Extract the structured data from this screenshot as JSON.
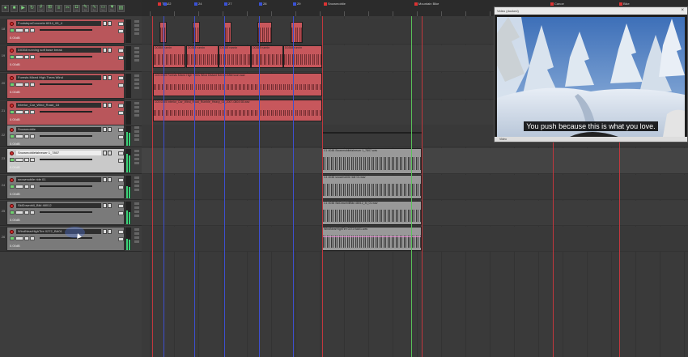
{
  "toolbar": {
    "buttons": [
      {
        "icon": "record-icon",
        "label": ""
      },
      {
        "icon": "stop-icon",
        "label": ""
      },
      {
        "icon": "play-icon",
        "label": ""
      },
      {
        "icon": "loop-icon",
        "label": ""
      },
      {
        "icon": "grid-icon",
        "label": "Grid"
      },
      {
        "icon": "snap-icon",
        "label": "Snap"
      },
      {
        "icon": "ripple-icon",
        "label": ""
      },
      {
        "icon": "trim-icon",
        "label": ""
      },
      {
        "icon": "lock-icon",
        "label": "Lock"
      },
      {
        "icon": "edit-icon",
        "label": "Edit"
      },
      {
        "icon": "envelope-icon",
        "label": "Env"
      },
      {
        "icon": "item-icon",
        "label": "Item"
      },
      {
        "icon": "marker-icon",
        "label": "Mark"
      },
      {
        "icon": "region-icon",
        "label": ""
      }
    ]
  },
  "markers": [
    {
      "label": "Tick",
      "color": "#d33"
    },
    {
      "label": "22",
      "color": "#3a52d6"
    },
    {
      "label": "24",
      "color": "#3a52d6"
    },
    {
      "label": "27",
      "color": "#3a52d6"
    },
    {
      "label": "28",
      "color": "#3a52d6"
    },
    {
      "label": "29",
      "color": "#3a52d6"
    },
    {
      "label": "Snowmobile",
      "color": "#d33"
    },
    {
      "label": "Mountain Bike",
      "color": "#d33"
    },
    {
      "label": "Canoe",
      "color": "#d33"
    },
    {
      "label": "Bike",
      "color": "#d33"
    }
  ],
  "tracks": [
    {
      "num": "18",
      "name": "FootstepsConcrete 6014_05_4",
      "volume": "0.00dB",
      "kind": "red"
    },
    {
      "num": "19",
      "name": "D0358 running soft base break",
      "volume": "0.00dB",
      "kind": "red"
    },
    {
      "num": "20",
      "name": "Forests Mixed High Trees Wind",
      "volume": "0.00dB",
      "kind": "red"
    },
    {
      "num": "21",
      "name": "Interior_Car_Wind_Road_18",
      "volume": "0.00dB",
      "kind": "red"
    },
    {
      "num": "22",
      "name": "Snowmobile",
      "volume": "0.00dB",
      "kind": "folder"
    },
    {
      "num": "23",
      "name": "Snowmobilefahreuer 1_7807",
      "volume": "0.00dB",
      "kind": "light"
    },
    {
      "num": "24",
      "name": "snowmobile ride 01",
      "volume": "0.00dB",
      "kind": "gray"
    },
    {
      "num": "25",
      "name": "SkiDownhill_Bikl 48012",
      "volume": "0.00dB",
      "kind": "gray"
    },
    {
      "num": "26",
      "name": "WindNearHighTire 0272_BA01",
      "volume": "0.00dB",
      "kind": "gray"
    }
  ],
  "track_side_label": "upmixe",
  "items": [
    {
      "label": "",
      "kind": "red"
    },
    {
      "label": "",
      "kind": "red"
    },
    {
      "label": "",
      "kind": "red"
    },
    {
      "label": "",
      "kind": "red"
    },
    {
      "label": "",
      "kind": "red"
    },
    {
      "label": "D0358 runnin",
      "kind": "red"
    },
    {
      "label": "D0358 runnin",
      "kind": "red"
    },
    {
      "label": "D0358 runnin",
      "kind": "red"
    },
    {
      "label": "D0358 runnin",
      "kind": "red"
    },
    {
      "label": "D0358 runnin",
      "kind": "red"
    },
    {
      "label": "C03 0385 Forests Mixed High Trees Wind Distant Nerrad Afternoon.wav",
      "kind": "red"
    },
    {
      "label": "C03 0385 Interior_Car_Wind_Road_Rumble_Heavy_01_2007-0804 08.wav",
      "kind": "red"
    },
    {
      "label": "C1 4048 Snowmobilefahreuer 1_7807.wav",
      "kind": "gray"
    },
    {
      "label": "C4 4048 snowmobile ride 01.wav",
      "kind": "gray"
    },
    {
      "label": "C1 4048 SkiDownhillBikl 48012_M_01.wav",
      "kind": "gray"
    },
    {
      "label": "WindNearHighTire 0272 BA01.wav",
      "kind": "gray"
    }
  ],
  "video_window": {
    "title": "Video (docked)",
    "close": "×",
    "subtitle": "You push because this is what you love.",
    "status": "Video"
  },
  "colors": {
    "region_red": "#c7575c",
    "marker_blue": "#3d4fd0",
    "marker_red": "#c2373d",
    "playhead_green": "#59c159",
    "meter_green": "#3dd17a"
  }
}
